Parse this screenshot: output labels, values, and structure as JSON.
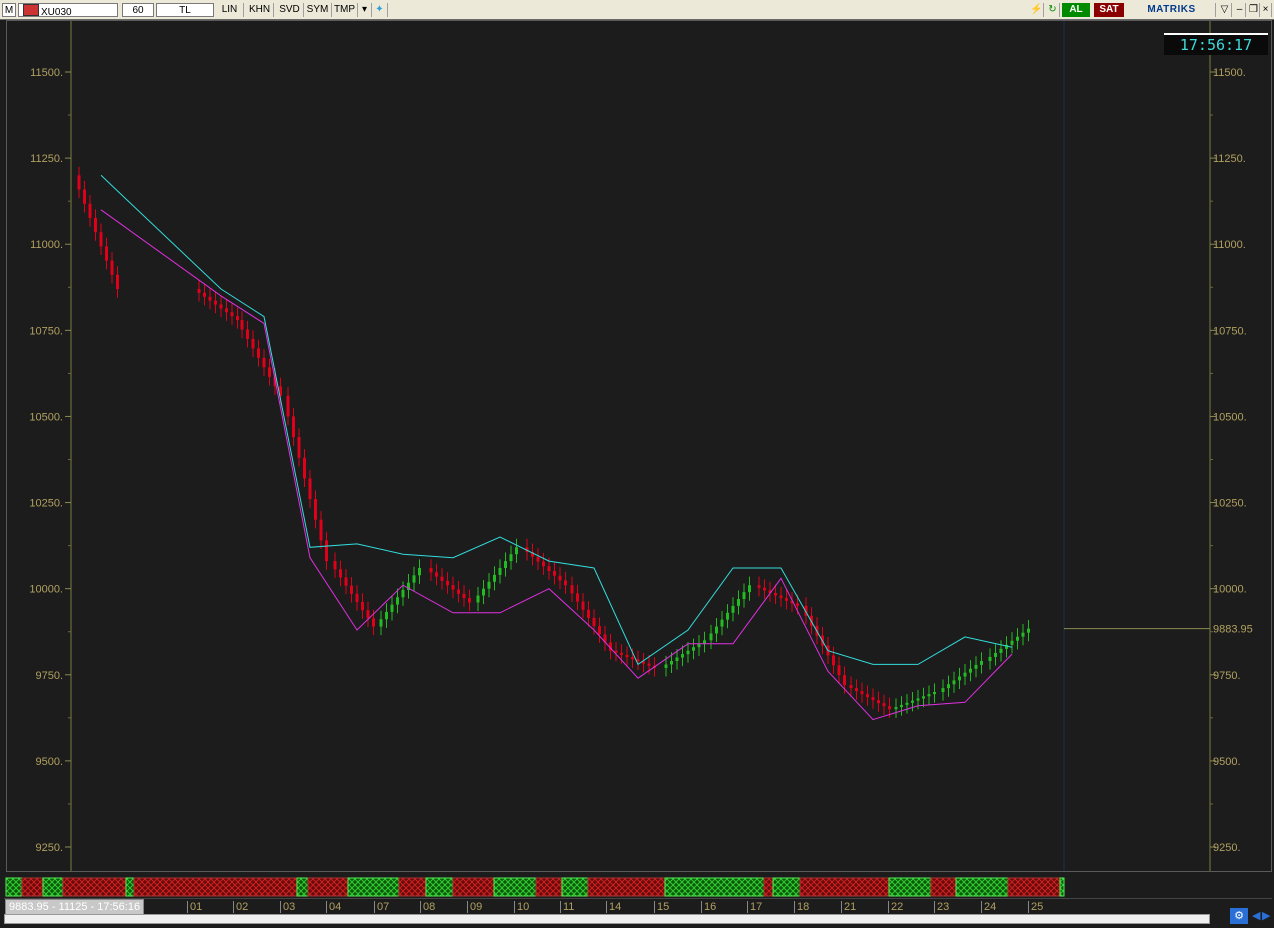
{
  "toolbar": {
    "menu_label": "M",
    "symbol": "XU030",
    "period": "60",
    "currency": "TL",
    "buttons": [
      "LIN",
      "KHN",
      "SVD",
      "SYM",
      "TMP"
    ],
    "buy_label": "AL",
    "sell_label": "SAT",
    "brand": "MATRIKS"
  },
  "clock": "17:56:17",
  "status_readout": "9883.95 - 11125 - 17:56:16",
  "last_price_label": "9883.95",
  "y_axis": {
    "labels": [
      "11500.",
      "11250.",
      "11000.",
      "10750.",
      "10500.",
      "10250.",
      "10000.",
      "9750.",
      "9500.",
      "9250."
    ],
    "values": [
      11500,
      11250,
      11000,
      10750,
      10500,
      10250,
      10000,
      9750,
      9500,
      9250
    ]
  },
  "date_axis": [
    "01",
    "02",
    "03",
    "04",
    "07",
    "08",
    "09",
    "10",
    "11",
    "14",
    "15",
    "16",
    "17",
    "18",
    "21",
    "22",
    "23",
    "24",
    "25"
  ],
  "colors": {
    "background": "#1c1c1c",
    "bull": "#22bb22",
    "bear": "#e0001a",
    "upper_band": "#33dddd",
    "lower_band": "#e030e0",
    "axis_text": "#b0a060"
  },
  "chart_data": {
    "type": "line",
    "title": "",
    "ylim": [
      9200,
      11650
    ],
    "x": [
      "01",
      "02",
      "03",
      "04",
      "07",
      "08",
      "09",
      "10",
      "11",
      "14",
      "15",
      "16",
      "17",
      "18",
      "21",
      "22",
      "23",
      "24",
      "25"
    ],
    "price_close": [
      10870,
      10780,
      10560,
      10080,
      9890,
      10060,
      9960,
      10120,
      10010,
      9820,
      9770,
      9850,
      10010,
      9950,
      9720,
      9650,
      9700,
      9790,
      9884
    ],
    "series": [
      {
        "name": "upper",
        "values": [
          11200,
          10870,
          10790,
          10120,
          10130,
          10100,
          10090,
          10150,
          10080,
          10060,
          9780,
          9880,
          10060,
          10060,
          9820,
          9780,
          9780,
          9860,
          9830
        ]
      },
      {
        "name": "lower",
        "values": [
          11100,
          10850,
          10770,
          10090,
          9880,
          10010,
          9930,
          9930,
          10000,
          9880,
          9740,
          9840,
          9840,
          10030,
          9760,
          9620,
          9660,
          9670,
          9810
        ]
      }
    ],
    "signals": [
      "bull",
      "bear",
      "bull",
      "bear",
      "bull",
      "bear",
      "bull",
      "bear",
      "bull",
      "bear",
      "bull",
      "bear",
      "bull",
      "bear",
      "bull",
      "bear",
      "bull",
      "bear",
      "bull",
      "bear",
      "bull",
      "bear",
      "bull",
      "bear",
      "bull",
      "bear",
      "bull"
    ]
  }
}
